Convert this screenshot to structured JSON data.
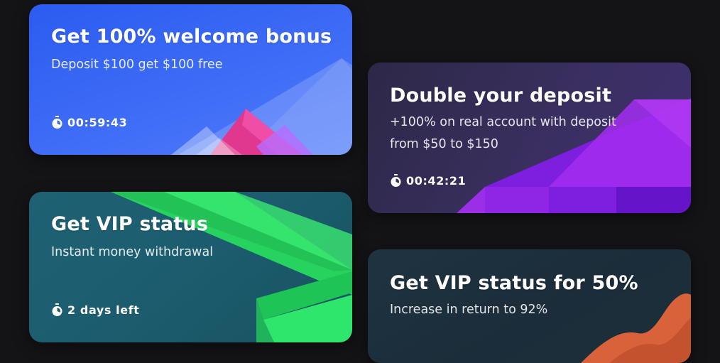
{
  "promotions": [
    {
      "title": "Get 100% welcome bonus",
      "subtitle_lines": [
        "Deposit $100 get $100 free"
      ],
      "timer": "00:59:43",
      "accent": "#2b5cf0"
    },
    {
      "title": "Double your deposit",
      "subtitle_lines": [
        "+100% on real account with deposit",
        "from $50 to $150"
      ],
      "timer": "00:42:21",
      "accent": "#7a1fe0"
    },
    {
      "title": "Get VIP status",
      "subtitle_lines": [
        "Instant money withdrawal"
      ],
      "timer": "2 days left",
      "accent": "#2ee66b"
    },
    {
      "title": "Get VIP status for 50%",
      "subtitle_lines": [
        "Increase in return to 92%"
      ],
      "accent": "#d9623b"
    }
  ],
  "icons": {
    "timer": "stopwatch-icon"
  }
}
